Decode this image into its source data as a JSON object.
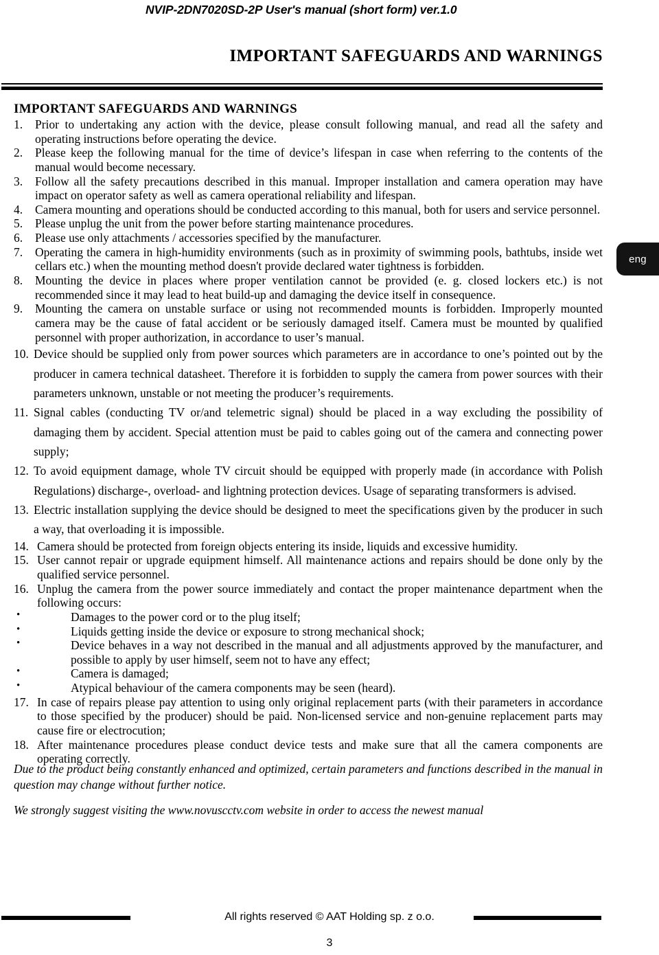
{
  "header": {
    "running_title": "NVIP-2DN7020SD-2P User's manual (short form) ver.1.0",
    "chapter_title": "IMPORTANT SAFEGUARDS AND WARNINGS"
  },
  "language_tab": {
    "label": "eng"
  },
  "main": {
    "section_heading": "IMPORTANT SAFEGUARDS AND WARNINGS",
    "items": [
      {
        "num": "1.",
        "text": "Prior to undertaking any action with the device, please consult following manual, and read all the safety and operating instructions before operating the device."
      },
      {
        "num": "2.",
        "text": "Please keep the following manual for the time of device’s lifespan in case when referring to the   contents of the manual would become necessary."
      },
      {
        "num": "3.",
        "text": "Follow all the safety precautions described in this manual. Improper installation and camera operation may have impact on operator safety as well as camera operational reliability and lifespan."
      },
      {
        "num": "4.",
        "text": "Camera mounting and operations should be conducted according to this manual, both for users and service personnel."
      },
      {
        "num": "5.",
        "text": "Please unplug the unit from the power before starting maintenance procedures."
      },
      {
        "num": "6.",
        "text": "Please use only attachments / accessories specified by the manufacturer."
      },
      {
        "num": "7.",
        "text": "Operating the camera in high-humidity environments (such as in proximity of swimming pools, bathtubs, inside wet cellars etc.) when the mounting method doesn't provide declared water tightness is forbidden."
      },
      {
        "num": "8.",
        "text": "Mounting the device in places where proper ventilation cannot be provided (e. g. closed lockers etc.) is not recommended since it may lead to heat build-up and damaging the device itself in consequence."
      },
      {
        "num": "9.",
        "text": "Mounting the camera on unstable surface or using not recommended mounts is forbidden. Improperly mounted camera may be the cause of fatal accident or be seriously damaged itself. Camera must be mounted by qualified personnel with proper authorization, in accordance to user’s manual."
      },
      {
        "num": "10.",
        "text": "Device should be supplied only from power sources which parameters are in accordance to one’s pointed out by the producer in camera technical datasheet. Therefore it is forbidden to supply the camera from power sources with their parameters unknown, unstable or not meeting the producer’s requirements."
      },
      {
        "num": "11.",
        "text": "Signal cables (conducting TV or/and telemetric signal) should be placed in a way excluding the possibility of damaging them by accident. Special attention must be paid to cables going out of the camera and connecting power supply;"
      },
      {
        "num": "12.",
        "text": "To avoid equipment damage, whole TV circuit should be equipped with properly made (in accordance with Polish Regulations) discharge-, overload- and lightning protection devices. Usage of separating transformers is advised."
      },
      {
        "num": "13.",
        "text": "Electric installation supplying the device should be designed to meet the specifications given by the producer in such a way, that overloading it is impossible."
      },
      {
        "num": "14.",
        "text": "Camera should be protected from foreign objects entering its inside, liquids and excessive humidity."
      },
      {
        "num": "15.",
        "text": "User cannot repair or upgrade equipment himself. All maintenance actions and repairs should be done only by the qualified service personnel."
      },
      {
        "num": "16.",
        "text": "Unplug the camera from the power source immediately and contact the proper maintenance department when the following occurs:"
      },
      {
        "num": "17.",
        "text": "In case of repairs please pay attention to using only original replacement parts (with their parameters in accordance to those specified by the producer) should be paid. Non-licensed service and non-genuine replacement parts may cause fire or electrocution;"
      },
      {
        "num": "18.",
        "text": "After maintenance procedures please conduct device tests and make sure that all the camera components are operating correctly."
      }
    ],
    "occurrences": [
      {
        "bullet": "•",
        "text": "Damages to the power cord or to the plug itself;"
      },
      {
        "bullet": "•",
        "text": "Liquids getting inside the device or exposure to strong mechanical shock;"
      },
      {
        "bullet": "•",
        "text": "Device behaves in a way not described in the manual and all adjustments approved by the manufacturer, and possible to apply by user himself, seem not to have any effect;"
      },
      {
        "bullet": "•",
        "text": "Camera is damaged;"
      },
      {
        "bullet": "•",
        "text": "Atypical behaviour of the camera components may be seen (heard)."
      }
    ],
    "notes": [
      "Due to the product being constantly enhanced and optimized, certain parameters and functions described in the manual in question may change without further notice.",
      "We strongly suggest visiting the www.novuscctv.com website in order to access the newest manual"
    ]
  },
  "footer": {
    "copyright": "All rights reserved © AAT Holding sp. z o.o.",
    "page_number": "3"
  }
}
